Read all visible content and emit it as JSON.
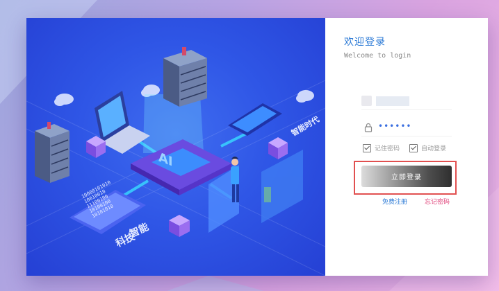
{
  "login": {
    "title": "欢迎登录",
    "subtitle": "Welcome to login",
    "password_mask": "••••••",
    "remember_label": "记住密码",
    "auto_login_label": "自动登录",
    "submit_label": "立即登录",
    "register_link": "免费注册",
    "forgot_link": "忘记密码"
  },
  "illustration": {
    "caption_top": "智能时代",
    "caption_bottom_line1": "智能",
    "caption_bottom_line2": "科技",
    "chip_label": "AI",
    "binary_rows": [
      "10000101010",
      "10010010",
      "11100100",
      "10100100",
      "10101010"
    ]
  },
  "colors": {
    "accent": "#2d7bd6",
    "link_pink": "#e0457b",
    "highlight": "#e15050",
    "panel_blue": "#2f56e6"
  }
}
